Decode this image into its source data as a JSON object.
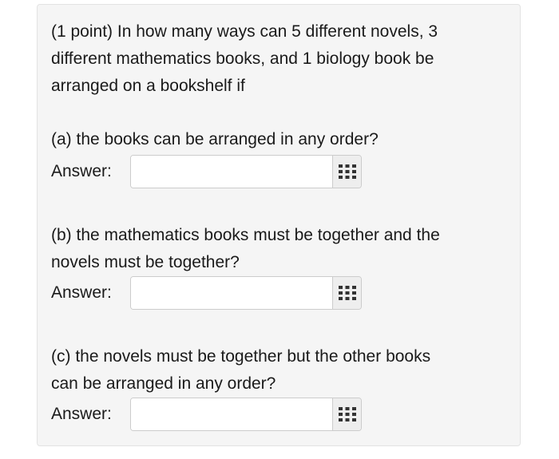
{
  "problem": {
    "intro_lines": [
      "(1 point) In how many ways can 5 different novels, 3",
      "different mathematics books, and 1 biology book be",
      "arranged on a bookshelf if"
    ]
  },
  "parts": [
    {
      "question_lines": [
        "(a) the books can be arranged in any order?"
      ],
      "answer_label": "Answer:",
      "answer_value": "",
      "palette_icon": "grid-icon"
    },
    {
      "question_lines": [
        "(b) the mathematics books must be together and the",
        "novels must be together?"
      ],
      "answer_label": "Answer:",
      "answer_value": "",
      "palette_icon": "grid-icon"
    },
    {
      "question_lines": [
        "(c) the novels must be together but the other books",
        "can be arranged in any order?"
      ],
      "answer_label": "Answer:",
      "answer_value": "",
      "palette_icon": "grid-icon"
    }
  ],
  "colors": {
    "panel_background": "#f5f5f5",
    "text": "#1a1a1a",
    "icon": "#333333"
  }
}
